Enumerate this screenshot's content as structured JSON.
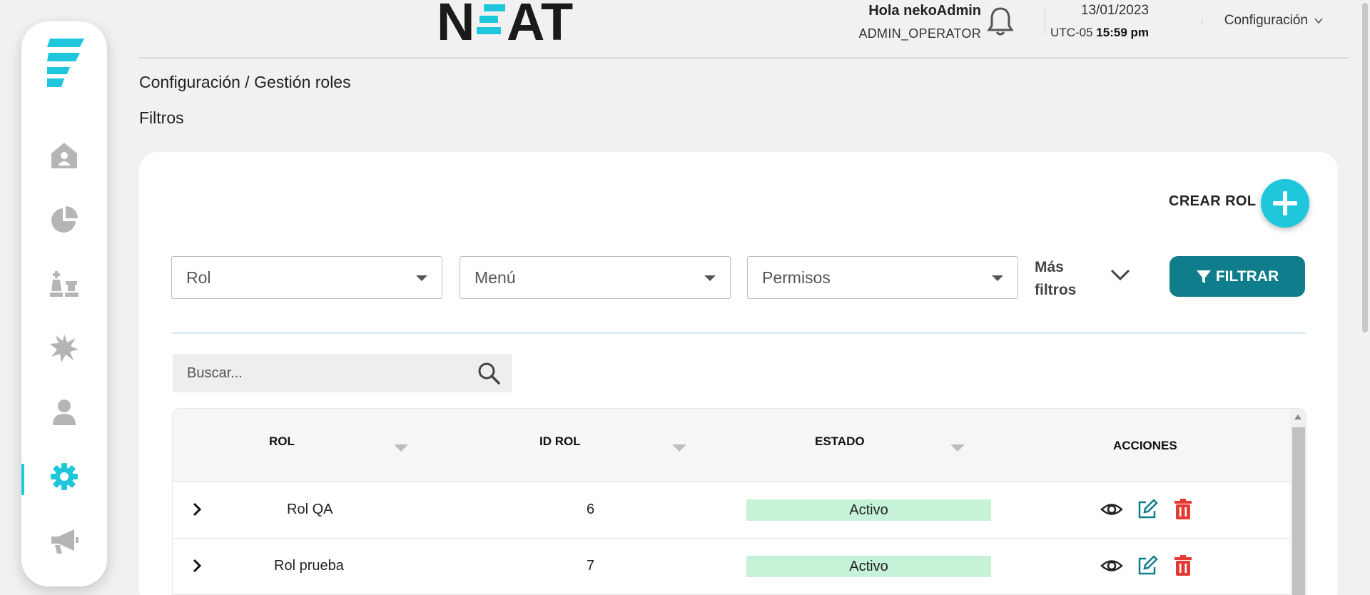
{
  "brand": {
    "name": "NEAT",
    "accent": "#1fc7dc",
    "dark": "#1a1a1a"
  },
  "sidebar": {
    "items": [
      {
        "name": "home",
        "icon": "home-user-icon",
        "active": false
      },
      {
        "name": "reports",
        "icon": "pie-chart-icon",
        "active": false
      },
      {
        "name": "strategy",
        "icon": "chess-pieces-icon",
        "active": false
      },
      {
        "name": "incidents",
        "icon": "burst-icon",
        "active": false
      },
      {
        "name": "users",
        "icon": "user-icon",
        "active": false
      },
      {
        "name": "settings",
        "icon": "gear-icon",
        "active": true
      },
      {
        "name": "campaigns",
        "icon": "megaphone-icon",
        "active": false
      }
    ]
  },
  "header": {
    "greeting": "Hola nekoAdmin",
    "role": "ADMIN_OPERATOR",
    "date": "13/01/2023",
    "timezone": "UTC-05",
    "time": "15:59 pm",
    "menu_label": "Configuración"
  },
  "breadcrumb": "Configuración / Gestión roles",
  "filters_title": "Filtros",
  "actions": {
    "create_label": "CREAR ROL",
    "filter_label": "FILTRAR"
  },
  "filters": {
    "role_placeholder": "Rol",
    "menu_placeholder": "Menú",
    "permissions_placeholder": "Permisos",
    "more_line1": "Más",
    "more_line2": "filtros"
  },
  "search": {
    "placeholder": "Buscar..."
  },
  "table": {
    "columns": {
      "role": "ROL",
      "id": "ID ROL",
      "status": "ESTADO",
      "actions": "ACCIONES"
    },
    "rows": [
      {
        "role": "Rol QA",
        "id": "6",
        "status": "Activo"
      },
      {
        "role": "Rol prueba",
        "id": "7",
        "status": "Activo"
      }
    ]
  },
  "colors": {
    "teal_button": "#0f7d8c",
    "active_status": "#c6f2d8",
    "delete": "#e53935",
    "edit": "#0f7d8c"
  }
}
